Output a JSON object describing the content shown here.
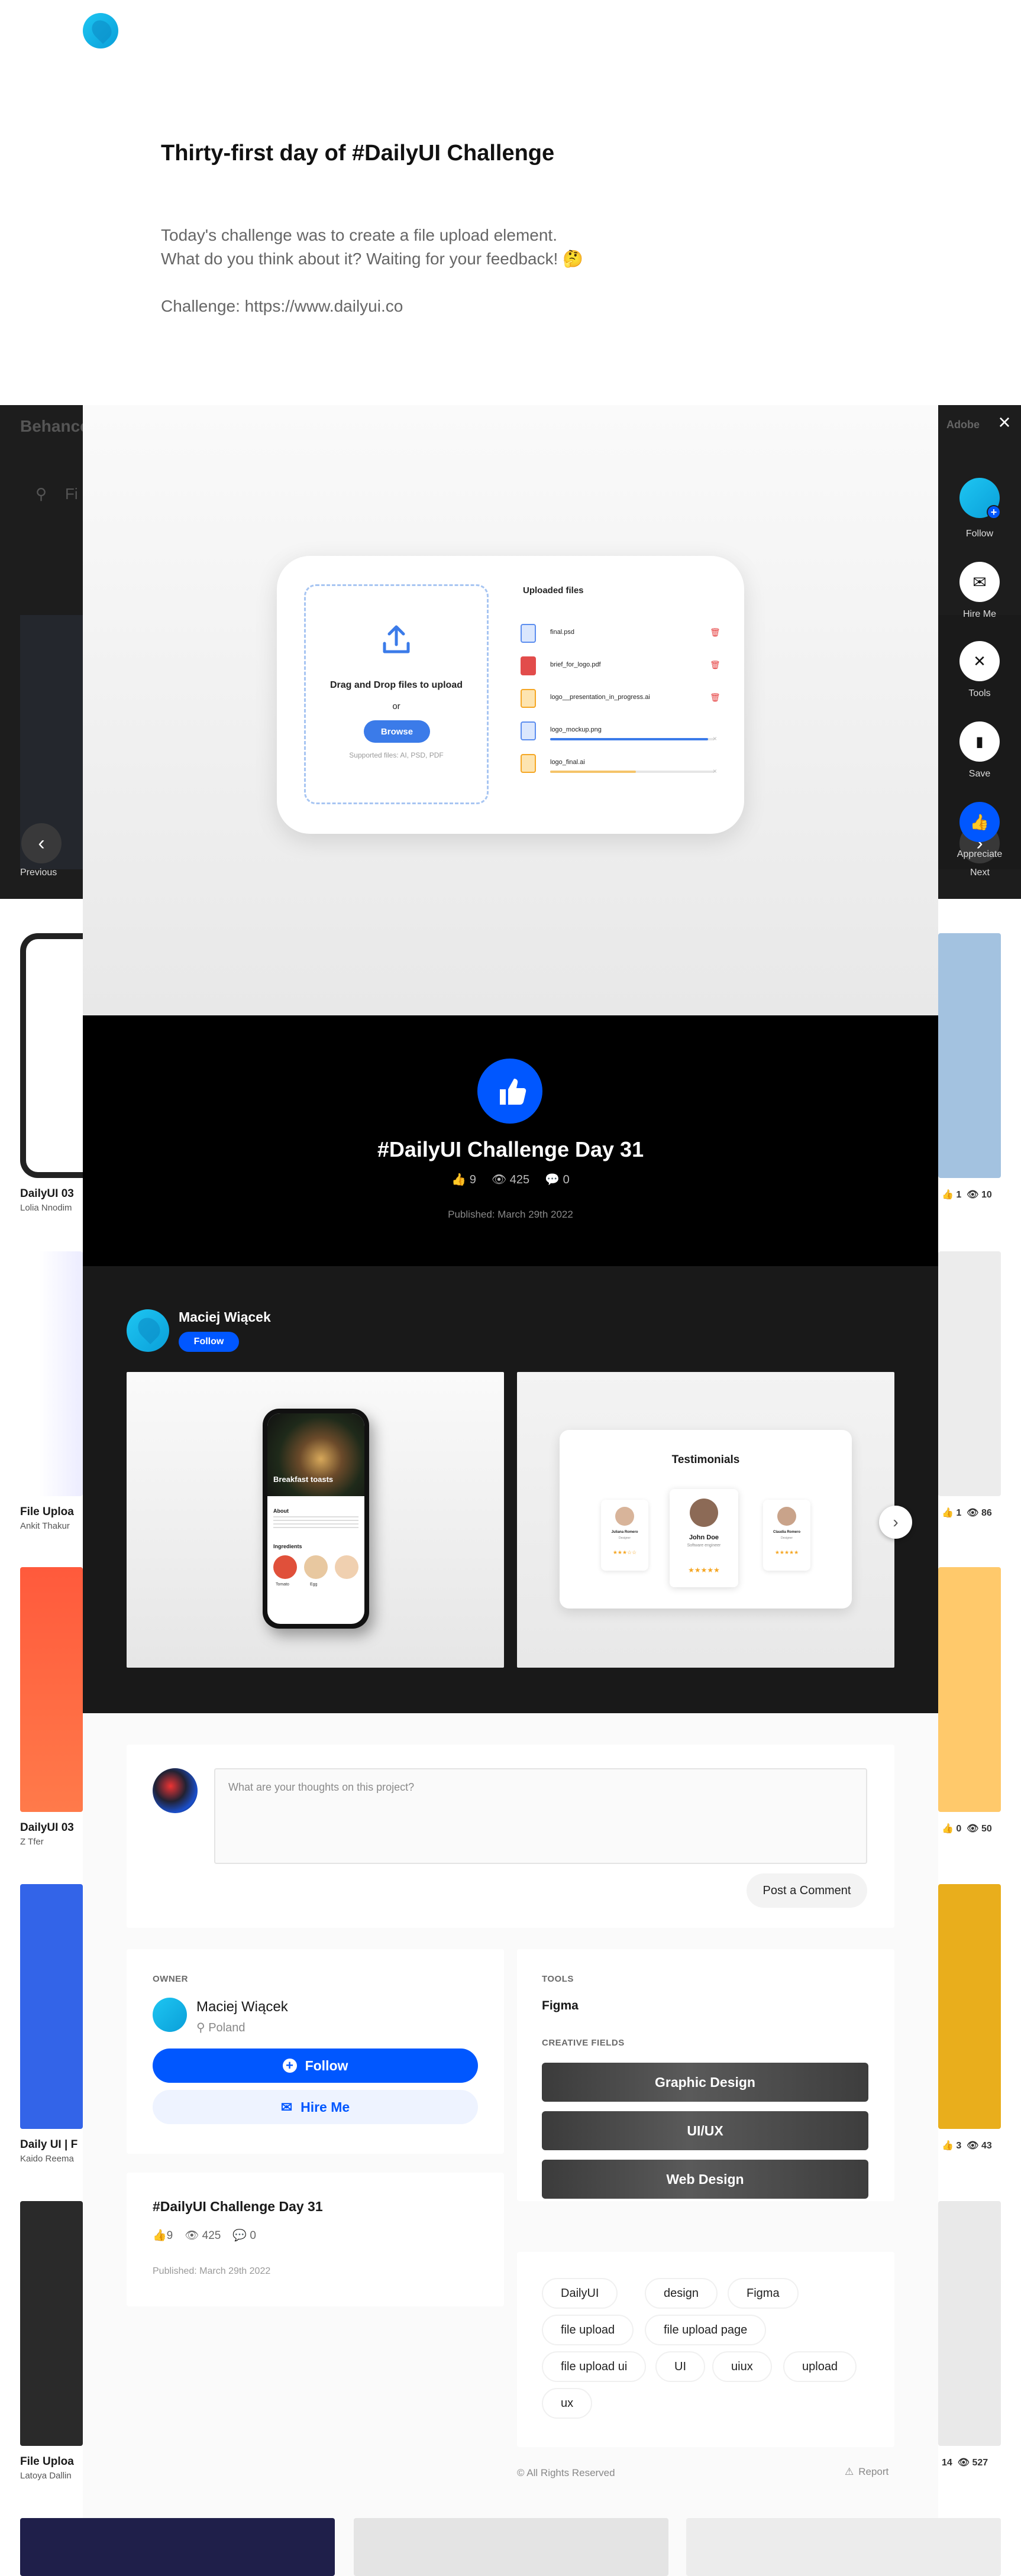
{
  "project": {
    "title": "Thirty-first day of #DailyUI Challenge",
    "desc_line1": "Today's challenge was to create a file upload element.",
    "desc_line2": "What do you think about it? Waiting for your feedback! 🤔",
    "desc_line3": "Challenge: https://www.dailyui.co"
  },
  "background": {
    "brand": "Behance",
    "search_hint": "Fi",
    "cards": [
      {
        "title": "DailyUI 03",
        "author": "Lolia Nnodim"
      },
      {
        "title": "File Uploa",
        "author": "Ankit Thakur"
      },
      {
        "title": "DailyUI 03",
        "author": "Z Tfer"
      },
      {
        "title": "Daily UI | F",
        "author": "Kaido Reema"
      },
      {
        "title": "File Uploa",
        "author": "Latoya Dallin"
      }
    ],
    "right_stats": [
      {
        "likes": "1",
        "views": "10"
      },
      {
        "likes": "1",
        "views": "86"
      },
      {
        "likes": "0",
        "views": "50"
      },
      {
        "likes": "3",
        "views": "43"
      },
      {
        "likes": "14",
        "views": "527"
      }
    ],
    "prev_label": "Previous",
    "next_label": "Next",
    "appreciate_label": "Appreciate",
    "adobe_label": "Adobe"
  },
  "mockup": {
    "drop_title": "Drag and Drop files to upload",
    "or": "or",
    "browse": "Browse",
    "supported": "Supported files: AI, PSD, PDF",
    "uploaded_title": "Uploaded files",
    "files": [
      {
        "name": "final.psd",
        "color": "#5b8def",
        "progress": ""
      },
      {
        "name": "brief_for_logo.pdf",
        "color": "#e24c4b",
        "progress": ""
      },
      {
        "name": "logo__presentation_in_progress.ai",
        "color": "#f5a623",
        "progress": ""
      },
      {
        "name": "logo_mockup.png",
        "color": "#5b8def",
        "progress": 0.96
      },
      {
        "name": "logo_final.ai",
        "color": "#f5a623",
        "progress": 0.52
      }
    ]
  },
  "band": {
    "title": "#DailyUI Challenge Day 31",
    "likes": "9",
    "views": "425",
    "comments": "0",
    "published": "Published: March 29th 2022"
  },
  "owner_band": {
    "name": "Maciej Wiącek",
    "follow": "Follow",
    "thumb1": {
      "app_title": "Breakfast toasts",
      "about": "About",
      "ingredients": "Ingredients",
      "items": [
        "Tomato",
        "Egg",
        ""
      ]
    },
    "thumb2": {
      "title": "Testimonials",
      "names": [
        "Juliana Romero",
        "John Doe",
        "Claudia Romero"
      ],
      "roles": [
        "Designer",
        "Software engineer",
        "Designer"
      ]
    }
  },
  "comment": {
    "placeholder": "What are your thoughts on this project?",
    "post": "Post a Comment"
  },
  "owner_panel": {
    "label": "OWNER",
    "name": "Maciej Wiącek",
    "location": "Poland",
    "follow": "Follow",
    "hire": "Hire Me"
  },
  "info_panel": {
    "title": "#DailyUI Challenge Day 31",
    "likes": "9",
    "views": "425",
    "comments": "0",
    "published": "Published: March 29th 2022"
  },
  "tools": {
    "label": "TOOLS",
    "value": "Figma",
    "fields_label": "CREATIVE FIELDS",
    "fields": [
      "Graphic Design",
      "UI/UX",
      "Web Design"
    ],
    "tags": [
      "DailyUI",
      "design",
      "Figma",
      "file upload",
      "file upload page",
      "file upload ui",
      "UI",
      "uiux",
      "upload",
      "ux"
    ]
  },
  "footer": {
    "rights": "© All Rights Reserved",
    "report": "Report"
  },
  "sidebar": {
    "follow": "Follow",
    "hire": "Hire Me",
    "tools": "Tools",
    "save": "Save"
  },
  "colors": {
    "accent": "#0057ff",
    "dark": "#191919"
  }
}
